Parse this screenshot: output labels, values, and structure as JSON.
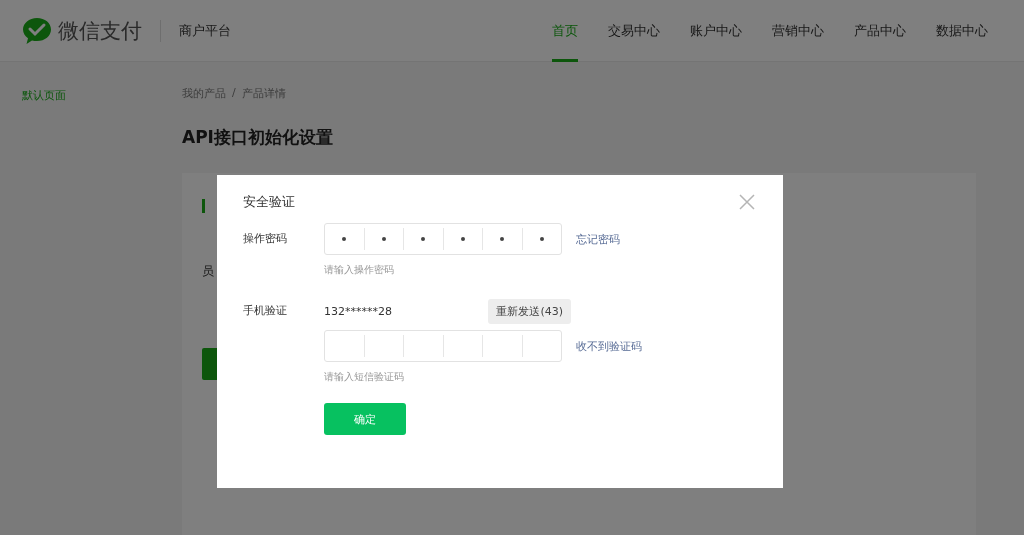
{
  "header": {
    "logo_text": "微信支付",
    "platform": "商户平台",
    "nav": [
      {
        "label": "首页",
        "selected": true
      },
      {
        "label": "交易中心",
        "selected": false
      },
      {
        "label": "账户中心",
        "selected": false
      },
      {
        "label": "营销中心",
        "selected": false
      },
      {
        "label": "产品中心",
        "selected": false
      },
      {
        "label": "数据中心",
        "selected": false
      }
    ]
  },
  "sidebar": {
    "items": [
      {
        "label": "默认页面",
        "selected": true
      }
    ]
  },
  "breadcrumb": {
    "items": [
      "我的产品",
      "产品详情"
    ],
    "separator": "/"
  },
  "page_title": "API接口初始化设置",
  "background_card": {
    "label": "员"
  },
  "dialog": {
    "title": "安全验证",
    "fields": [
      {
        "kind": "password",
        "label": "操作密码",
        "cells": [
          {
            "filled": true
          },
          {
            "filled": true
          },
          {
            "filled": true
          },
          {
            "filled": true
          },
          {
            "filled": true
          },
          {
            "filled": true
          }
        ],
        "link": "忘记密码",
        "hint": "请输入操作密码"
      },
      {
        "kind": "sms",
        "label": "手机验证",
        "phone": "132******28",
        "resend_button": "重新发送(43)",
        "cells": [
          {
            "filled": false
          },
          {
            "filled": false
          },
          {
            "filled": false
          },
          {
            "filled": false
          },
          {
            "filled": false
          },
          {
            "filled": false
          }
        ],
        "link": "收不到验证码",
        "hint": "请输入短信验证码"
      }
    ],
    "confirm_button": "确定"
  }
}
